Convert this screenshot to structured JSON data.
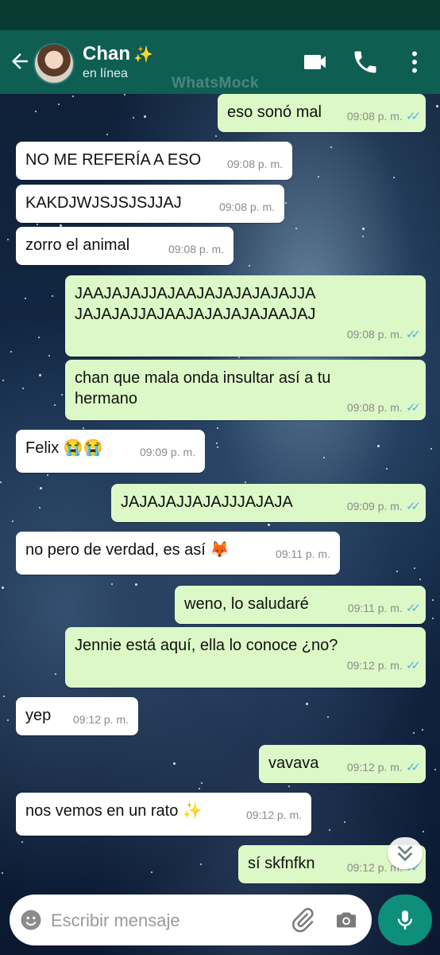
{
  "header": {
    "contact_name": "Chan",
    "name_emoji": "✨",
    "status": "en línea",
    "watermark": "WhatsMock"
  },
  "messages": [
    {
      "dir": "out",
      "text": "eso sonó mal",
      "time": "09:08 p. m."
    },
    {
      "dir": "in",
      "text": "NO ME REFERÍA A ESO",
      "time": "09:08 p. m."
    },
    {
      "dir": "in",
      "text": "KAKDJWJSJSJSJJAJ",
      "time": "09:08 p. m."
    },
    {
      "dir": "in",
      "text": "zorro el animal",
      "time": "09:08 p. m."
    },
    {
      "dir": "out",
      "text": "JAAJAJAJJAJAAJAJAJAJAJAJJA\nJAJAJAJJAJAAJAJAJAJAJAAJAJ",
      "time": "09:08 p. m."
    },
    {
      "dir": "out",
      "text": "chan que mala onda insultar así a tu\nhermano",
      "time": "09:08 p. m."
    },
    {
      "dir": "in",
      "text": "Felix",
      "emoji": "😭😭",
      "time": "09:09 p. m."
    },
    {
      "dir": "out",
      "text": "JAJAJAJJAJAJJJAJAJA",
      "time": "09:09 p. m."
    },
    {
      "dir": "in",
      "text": "no pero de verdad, es así",
      "emoji": "🦊",
      "time": "09:11 p. m."
    },
    {
      "dir": "out",
      "text": "weno, lo saludaré",
      "time": "09:11 p. m."
    },
    {
      "dir": "out",
      "text": "Jennie está aquí, ella lo conoce ¿no?",
      "time": "09:12 p. m."
    },
    {
      "dir": "in",
      "text": "yep",
      "time": "09:12 p. m."
    },
    {
      "dir": "out",
      "text": "vavava",
      "time": "09:12 p. m."
    },
    {
      "dir": "in",
      "text": "nos vemos en un rato",
      "emoji": "✨",
      "time": "09:12 p. m."
    },
    {
      "dir": "out",
      "text": "sí skfnfkn",
      "time": "09:12 p. m."
    }
  ],
  "composer": {
    "placeholder": "Escribir mensaje"
  },
  "colors": {
    "header": "#0e5e52",
    "outgoing_bubble": "#dcf8c6",
    "incoming_bubble": "#ffffff",
    "read_ticks": "#4fb2e3",
    "mic_button": "#0e8f7c"
  },
  "icons": {
    "back": "arrow-left-icon",
    "video": "video-call-icon",
    "phone": "phone-icon",
    "menu": "more-vert-icon",
    "emoji": "emoji-icon",
    "attach": "paperclip-icon",
    "camera": "camera-icon",
    "mic": "mic-icon",
    "scroll": "chevron-double-down-icon"
  }
}
